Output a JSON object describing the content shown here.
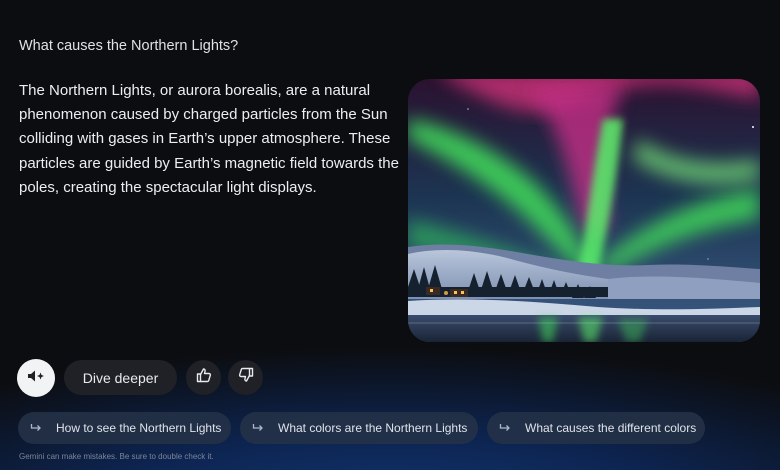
{
  "conversation": {
    "question": "What causes the Northern Lights?",
    "answer": "The Northern Lights, or aurora borealis, are a natural phenomenon caused by charged particles from the Sun colliding with gases in Earth’s upper atmosphere. These particles are guided by Earth’s magnetic field towards the poles, creating the spectacular light displays."
  },
  "image": {
    "subject": "aurora-over-snowy-forest"
  },
  "actions": {
    "mic_icon": "speaker-sparkle-icon",
    "dive_deeper_label": "Dive deeper",
    "thumbs_up_icon": "thumbs-up-icon",
    "thumbs_down_icon": "thumbs-down-icon"
  },
  "suggestions": [
    {
      "label": "How to see the Northern Lights",
      "icon": "reply-arrow-icon"
    },
    {
      "label": "What colors are the Northern Lights",
      "icon": "reply-arrow-icon"
    },
    {
      "label": "What causes the different colors",
      "icon": "reply-arrow-icon"
    }
  ],
  "disclaimer": "Gemini can make mistakes. Be sure to double check it.",
  "colors": {
    "background": "#0c0d10",
    "chip_background": "#263248",
    "button_background": "#1f2127",
    "aurora_green": "#4cdc5a",
    "aurora_magenta": "#d8347e"
  }
}
